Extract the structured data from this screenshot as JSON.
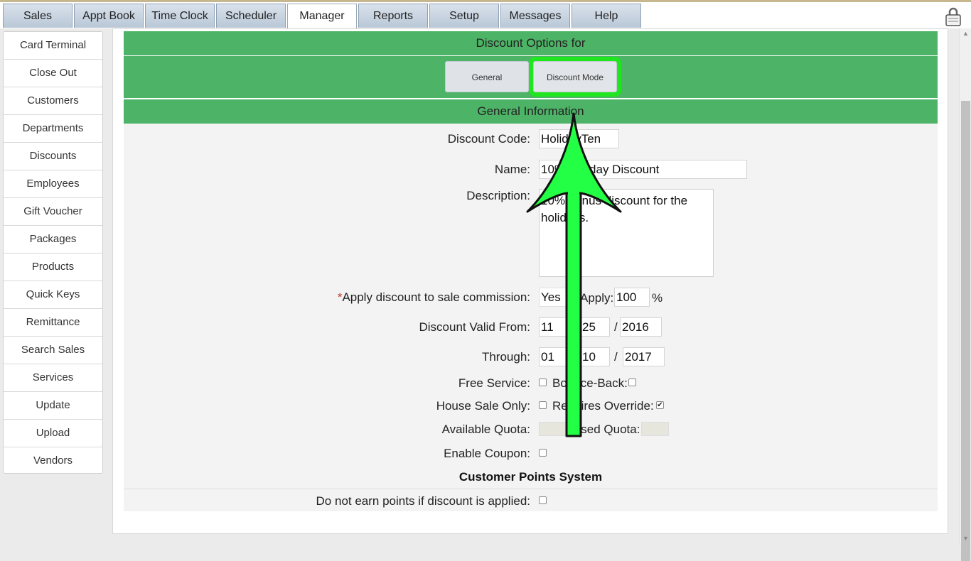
{
  "tabs": [
    "Sales",
    "Appt Book",
    "Time Clock",
    "Scheduler",
    "Manager",
    "Reports",
    "Setup",
    "Messages",
    "Help"
  ],
  "active_tab": "Manager",
  "sidebar": {
    "items": [
      "Card Terminal",
      "Close Out",
      "Customers",
      "Departments",
      "Discounts",
      "Employees",
      "Gift Voucher",
      "Packages",
      "Products",
      "Quick Keys",
      "Remittance",
      "Search Sales",
      "Services",
      "Update",
      "Upload",
      "Vendors"
    ]
  },
  "header": {
    "title": "Discount Options for"
  },
  "subtabs": {
    "general": "General",
    "discount_mode": "Discount Mode"
  },
  "section_general": "General Information",
  "form": {
    "discount_code_label": "Discount Code:",
    "discount_code_value": "HolidayTen",
    "name_label": "Name:",
    "name_value": "10% Holiday Discount",
    "description_label": "Description:",
    "description_value": "10% bonus discount for the holidays.",
    "apply_label": "Apply discount to sale commission:",
    "apply_select": "Yes",
    "apply_pct_label": "Apply:",
    "apply_pct_value": "100",
    "percent_sign": "%",
    "valid_from_label": "Discount Valid From:",
    "from_month": "11",
    "from_day": "25",
    "from_year": "2016",
    "through_label": "Through:",
    "through_month": "01",
    "through_day": "10",
    "through_year": "2017",
    "slash": "/",
    "free_service_label": "Free Service:",
    "bounce_back_label": "Bounce-Back:",
    "house_sale_label": "House Sale Only:",
    "requires_override_label": "Requires Override:",
    "available_quota_label": "Available Quota:",
    "used_quota_label": "Used Quota:",
    "enable_coupon_label": "Enable Coupon:"
  },
  "points": {
    "section_title": "Customer Points System",
    "no_earn_label": "Do not earn points if discount is applied:"
  },
  "colors": {
    "green_bar": "#4db366",
    "highlight": "#1fe61f",
    "arrow": "#22ff44"
  }
}
